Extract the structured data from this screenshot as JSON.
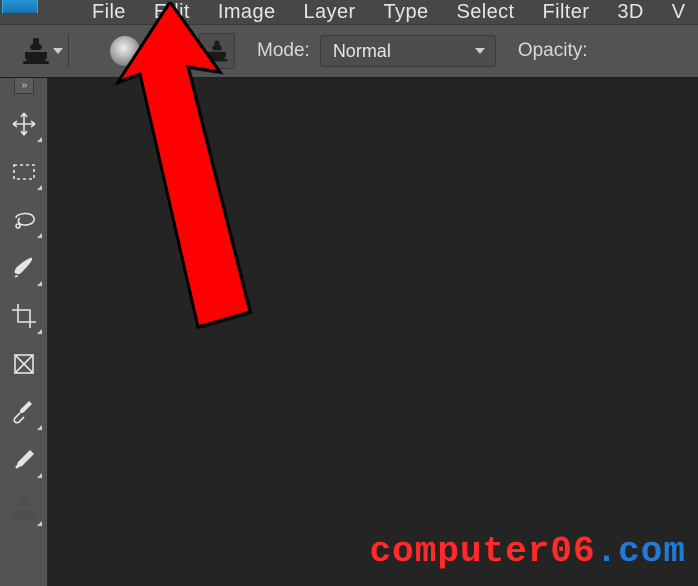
{
  "menu": {
    "items": [
      "File",
      "Edit",
      "Image",
      "Layer",
      "Type",
      "Select",
      "Filter",
      "3D",
      "V"
    ]
  },
  "options": {
    "mode_label": "Mode:",
    "mode_value": "Normal",
    "opacity_label": "Opacity:"
  },
  "sidebar": {
    "tools": [
      {
        "name": "move-tool"
      },
      {
        "name": "rectangular-marquee-tool"
      },
      {
        "name": "lasso-tool"
      },
      {
        "name": "brush-tool"
      },
      {
        "name": "crop-tool"
      },
      {
        "name": "frame-tool"
      },
      {
        "name": "eyedropper-tool"
      },
      {
        "name": "spot-healing-brush-tool"
      },
      {
        "name": "clone-stamp-tool"
      }
    ]
  },
  "watermark": {
    "part1": "computer06",
    "part2": ".com"
  },
  "annotation": {
    "target_menu": "Edit"
  }
}
